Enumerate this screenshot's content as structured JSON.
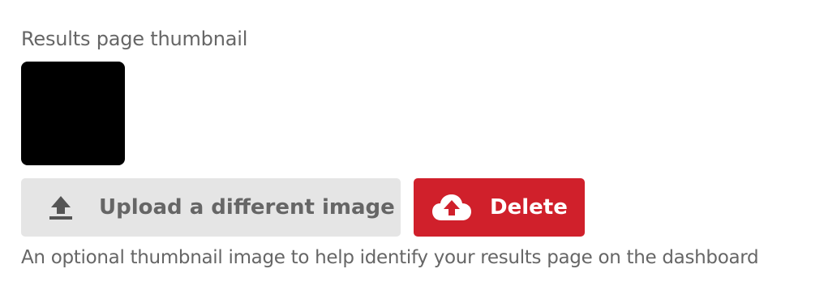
{
  "field": {
    "label": "Results page thumbnail",
    "help_text": "An optional thumbnail image to help identify your results page on the dashboard"
  },
  "buttons": {
    "upload": {
      "label": "Upload a different image",
      "icon": "upload-icon"
    },
    "delete": {
      "label": "Delete",
      "icon": "cloud-upload-icon"
    }
  },
  "colors": {
    "delete_background": "#d0202b",
    "upload_background": "#e5e5e5",
    "text": "#666666"
  }
}
